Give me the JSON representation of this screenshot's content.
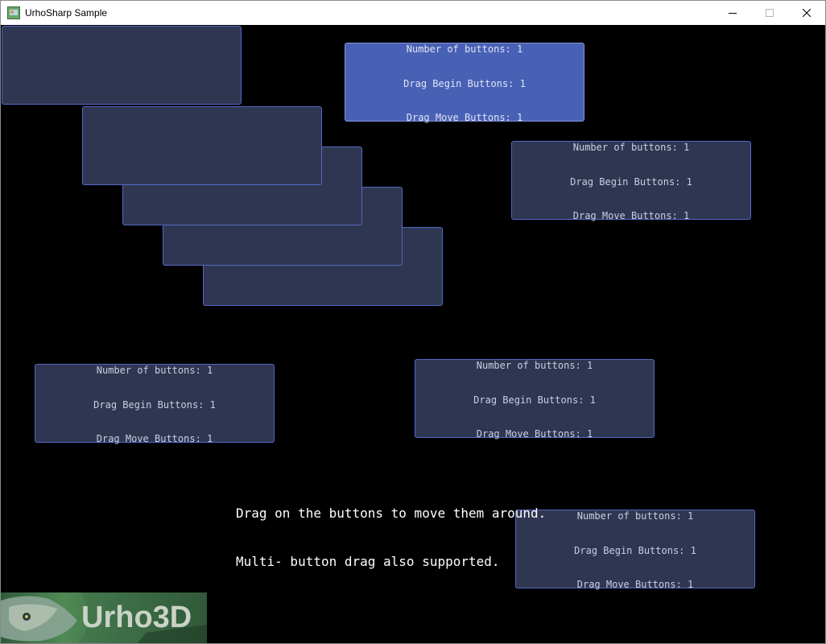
{
  "window": {
    "title": "UrhoSharp Sample",
    "controls": [
      "minimize-icon",
      "maximize-icon",
      "close-icon"
    ]
  },
  "drag_buttons": [
    {
      "lines": [
        "",
        "",
        ""
      ],
      "active": false
    },
    {
      "lines": [
        "",
        "",
        ""
      ],
      "active": false
    },
    {
      "lines": [
        "",
        "",
        ""
      ],
      "active": false
    },
    {
      "lines": [
        "",
        "",
        ""
      ],
      "active": false
    },
    {
      "lines": [
        "",
        "",
        ""
      ],
      "active": false
    },
    {
      "lines": [
        "Number of buttons: 1",
        "Drag Begin Buttons: 1",
        "Drag Move Buttons: 1"
      ],
      "active": true
    },
    {
      "lines": [
        "Number of buttons: 1",
        "Drag Begin Buttons: 1",
        "Drag Move Buttons: 1"
      ],
      "active": false
    },
    {
      "lines": [
        "Number of buttons: 1",
        "Drag Begin Buttons: 1",
        "Drag Move Buttons: 1"
      ],
      "active": false
    },
    {
      "lines": [
        "Number of buttons: 1",
        "Drag Begin Buttons: 1",
        "Drag Move Buttons: 1"
      ],
      "active": false
    },
    {
      "lines": [
        "Number of buttons: 1",
        "Drag Begin Buttons: 1",
        "Drag Move Buttons: 1"
      ],
      "active": false
    }
  ],
  "instructions": {
    "line1": "Drag on the buttons to move them around.",
    "line2": "Multi- button drag also supported."
  },
  "logo": {
    "text": "Urho3D"
  },
  "colors": {
    "button_fill": "#2f3651",
    "button_border": "#5468c4",
    "button_active_fill": "#4861b5",
    "background": "#000000"
  }
}
